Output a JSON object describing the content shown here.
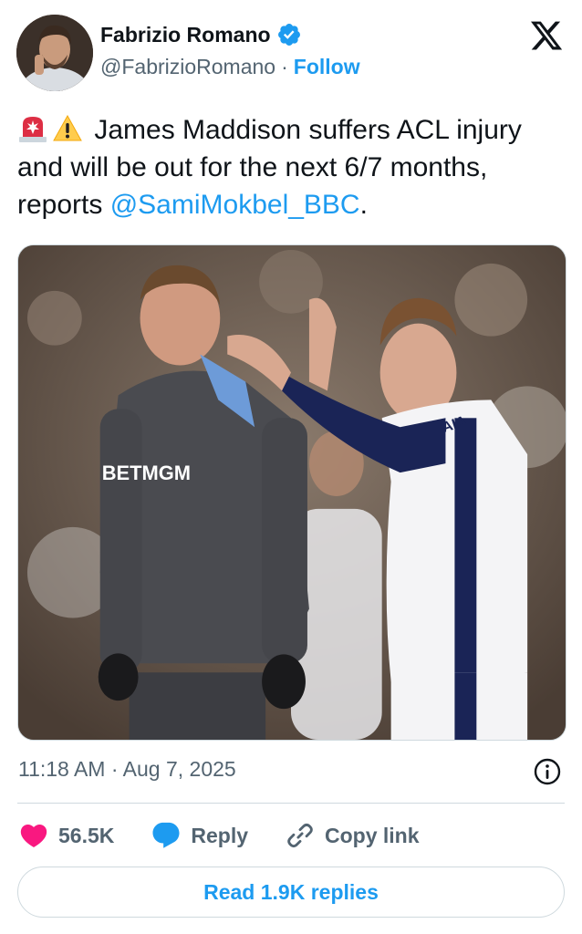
{
  "author": {
    "display_name": "Fabrizio Romano",
    "handle": "@FabrizioRomano",
    "separator": "·",
    "follow_label": "Follow"
  },
  "tweet": {
    "text_main": " James Maddison suffers ACL injury and will be out for the next 6/7 months, reports ",
    "mention": "@SamiMokbel_BBC",
    "text_end": ".",
    "emojis": [
      "rotating-light-icon",
      "warning-icon"
    ],
    "media": {
      "jersey_sponsor": "BETMGM",
      "shirt_sponsor": "AIA"
    }
  },
  "meta": {
    "timestamp": "11:18 AM · Aug 7, 2025"
  },
  "actions": {
    "like_count": "56.5K",
    "reply_label": "Reply",
    "copy_link_label": "Copy link"
  },
  "footer": {
    "read_replies_label": "Read 1.9K replies"
  },
  "colors": {
    "accent": "#1d9bf0",
    "like": "#f91880",
    "text": "#0f1419",
    "muted": "#536471"
  }
}
